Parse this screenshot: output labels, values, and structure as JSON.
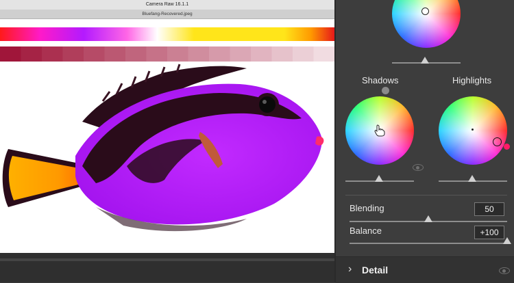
{
  "window": {
    "title": "Camera Raw 16.1.1",
    "filename": "Bluefang-Recovered.jpeg"
  },
  "colors": {
    "hue_bar": [
      "#ff1a1a",
      "#ff1ac8",
      "#b31aff",
      "#ff66e6",
      "#ffffff",
      "#ffe51a",
      "#ff9900",
      "#e6191a"
    ],
    "swatch_base": "#a0163a",
    "fish_body": "#b319ff"
  },
  "panel": {
    "midtones_wheel": {
      "label": ""
    },
    "shadows": {
      "label": "Shadows"
    },
    "highlights": {
      "label": "Highlights"
    },
    "blending": {
      "label": "Blending",
      "value": "50",
      "fraction": 0.5
    },
    "balance": {
      "label": "Balance",
      "value": "+100",
      "fraction": 1.0
    },
    "detail": {
      "label": "Detail"
    }
  }
}
